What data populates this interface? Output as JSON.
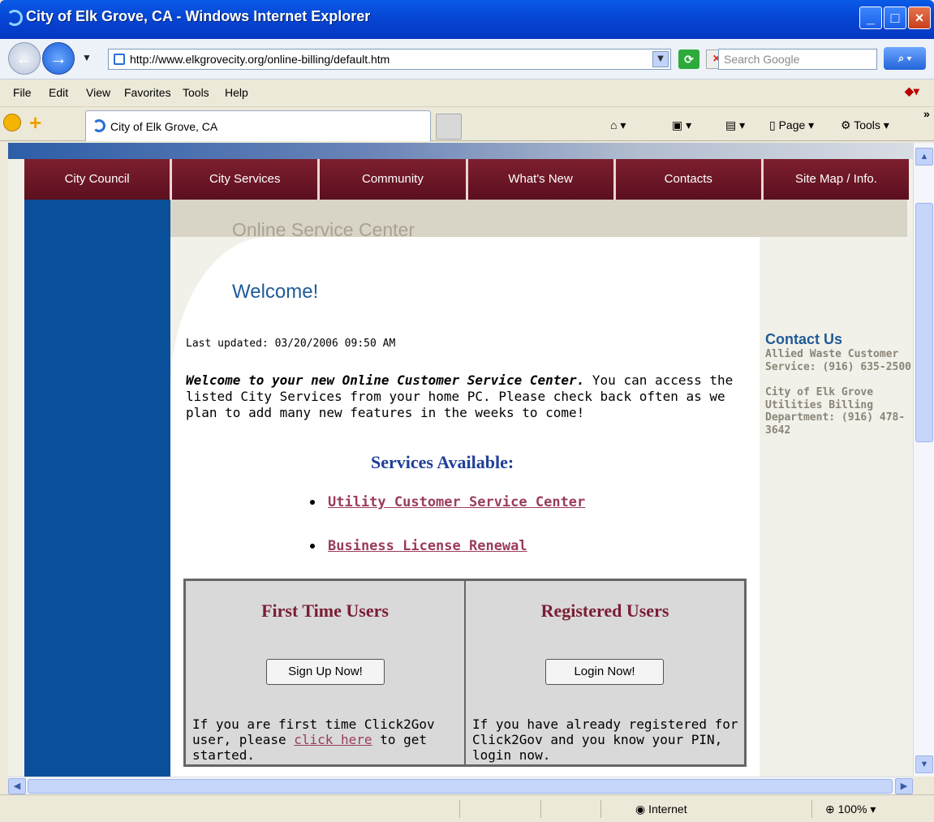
{
  "window": {
    "title": "City of Elk Grove, CA - Windows Internet Explorer"
  },
  "address": {
    "url": "http://www.elkgrovecity.org/online-billing/default.htm"
  },
  "search": {
    "placeholder": "Search Google"
  },
  "menu": [
    "File",
    "Edit",
    "View",
    "Favorites",
    "Tools",
    "Help"
  ],
  "tab": {
    "title": "City of Elk Grove, CA"
  },
  "commands": {
    "page": "Page",
    "tools": "Tools"
  },
  "nav": [
    "City Council",
    "City Services",
    "Community",
    "What's New",
    "Contacts",
    "Site Map / Info."
  ],
  "page": {
    "section_title": "Online Service Center",
    "welcome": "Welcome!",
    "last_updated": "Last updated: 03/20/2006 09:50 AM",
    "intro_bold": "Welcome to your new Online Customer Service Center.",
    "intro_rest": " You can access the listed City Services from your home PC. Please check back often as we plan to add many new features in the weeks to come!",
    "services_heading": "Services Available:",
    "services": [
      "Utility Customer Service Center",
      "Business License Renewal"
    ]
  },
  "users": {
    "first": {
      "title": "First Time Users",
      "button": "Sign Up Now!",
      "text_before": "If you are first time Click2Gov user, please ",
      "link": "click here",
      "text_after": " to get started."
    },
    "registered": {
      "title": "Registered Users",
      "button": "Login Now!",
      "text": "If you have already registered for Click2Gov and you know your PIN, login now."
    }
  },
  "contact": {
    "heading": "Contact Us",
    "allied": "Allied Waste Customer Service: (916) 635-2500",
    "city": "City of Elk Grove Utilities Billing Department: (916) 478-3642"
  },
  "status": {
    "zone": "Internet",
    "zoom": "100%"
  },
  "colors": {
    "nav": "#6b1425",
    "left": "#0a4f99",
    "heading_blue": "#1f5b98",
    "services_heading": "#1f3f9a",
    "link": "#9a3d5a"
  }
}
